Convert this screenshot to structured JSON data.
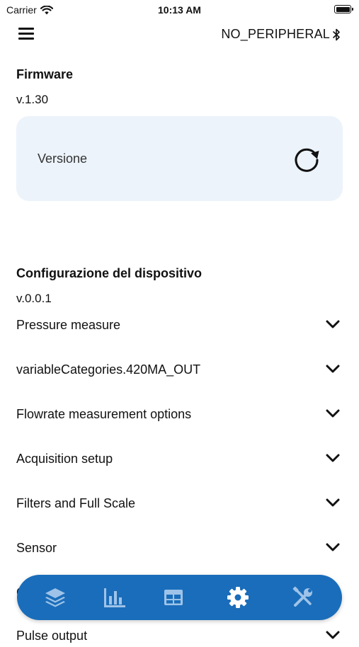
{
  "status_bar": {
    "carrier": "Carrier",
    "time": "10:13 AM"
  },
  "header": {
    "device_name": "NO_PERIPHERAL",
    "menu_icon": "hamburger-icon",
    "bluetooth_icon": "bluetooth-icon"
  },
  "firmware": {
    "title": "Firmware",
    "version": "v.1.30",
    "card_label": "Versione",
    "action_icon": "refresh-icon"
  },
  "configuration": {
    "title": "Configurazione del dispositivo",
    "version": "v.0.0.1",
    "sections": [
      "Pressure measure",
      "variableCategories.420MA_OUT",
      "Flowrate measurement options",
      "Acquisition setup",
      "Filters and Full Scale",
      "Sensor",
      "C",
      "Pulse output"
    ]
  },
  "bottom_nav": {
    "items": [
      "layers-icon",
      "bar-chart-icon",
      "table-icon",
      "settings-icon",
      "tools-icon"
    ],
    "active": "settings-icon"
  },
  "colors": {
    "accent": "#1a6dba",
    "card_bg": "#ecf3fb",
    "text": "#111111"
  }
}
